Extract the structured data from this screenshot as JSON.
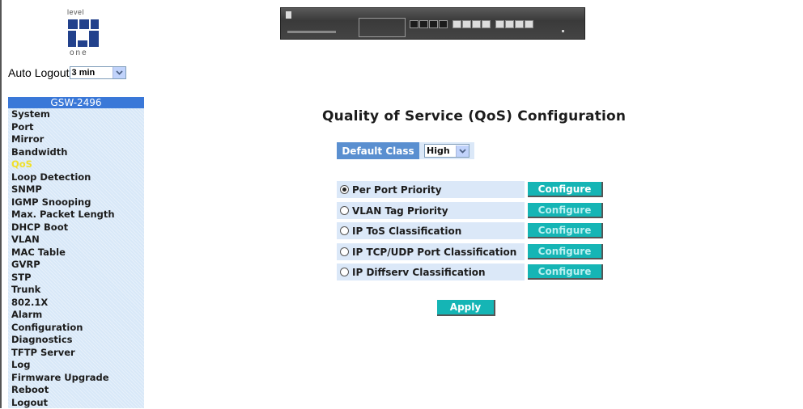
{
  "logo": {
    "top_text": "level",
    "bottom_text": "one"
  },
  "auto_logout": {
    "label": "Auto Logout",
    "value": "3 min"
  },
  "sidebar": {
    "title": "GSW-2496",
    "active": "QoS",
    "items": [
      "System",
      "Port",
      "Mirror",
      "Bandwidth",
      "QoS",
      "Loop Detection",
      "SNMP",
      "IGMP Snooping",
      "Max. Packet Length",
      "DHCP Boot",
      "VLAN",
      "MAC Table",
      "GVRP",
      "STP",
      "Trunk",
      "802.1X",
      "Alarm",
      "Configuration",
      "Diagnostics",
      "TFTP Server",
      "Log",
      "Firmware Upgrade",
      "Reboot",
      "Logout"
    ]
  },
  "main": {
    "title": "Quality of Service (QoS) Configuration",
    "default_class": {
      "label": "Default Class",
      "value": "High"
    },
    "options": [
      {
        "label": "Per Port Priority",
        "selected": true,
        "button": "Configure",
        "enabled": true
      },
      {
        "label": "VLAN Tag Priority",
        "selected": false,
        "button": "Configure",
        "enabled": false
      },
      {
        "label": "IP ToS Classification",
        "selected": false,
        "button": "Configure",
        "enabled": false
      },
      {
        "label": "IP TCP/UDP Port Classification",
        "selected": false,
        "button": "Configure",
        "enabled": false
      },
      {
        "label": "IP Diffserv Classification",
        "selected": false,
        "button": "Configure",
        "enabled": false
      }
    ],
    "apply_label": "Apply"
  },
  "colors": {
    "accent": "#15b5b5",
    "label_bg": "#5a8fd0",
    "row_bg": "#dbe8f8",
    "active_menu": "#f0e02a"
  }
}
